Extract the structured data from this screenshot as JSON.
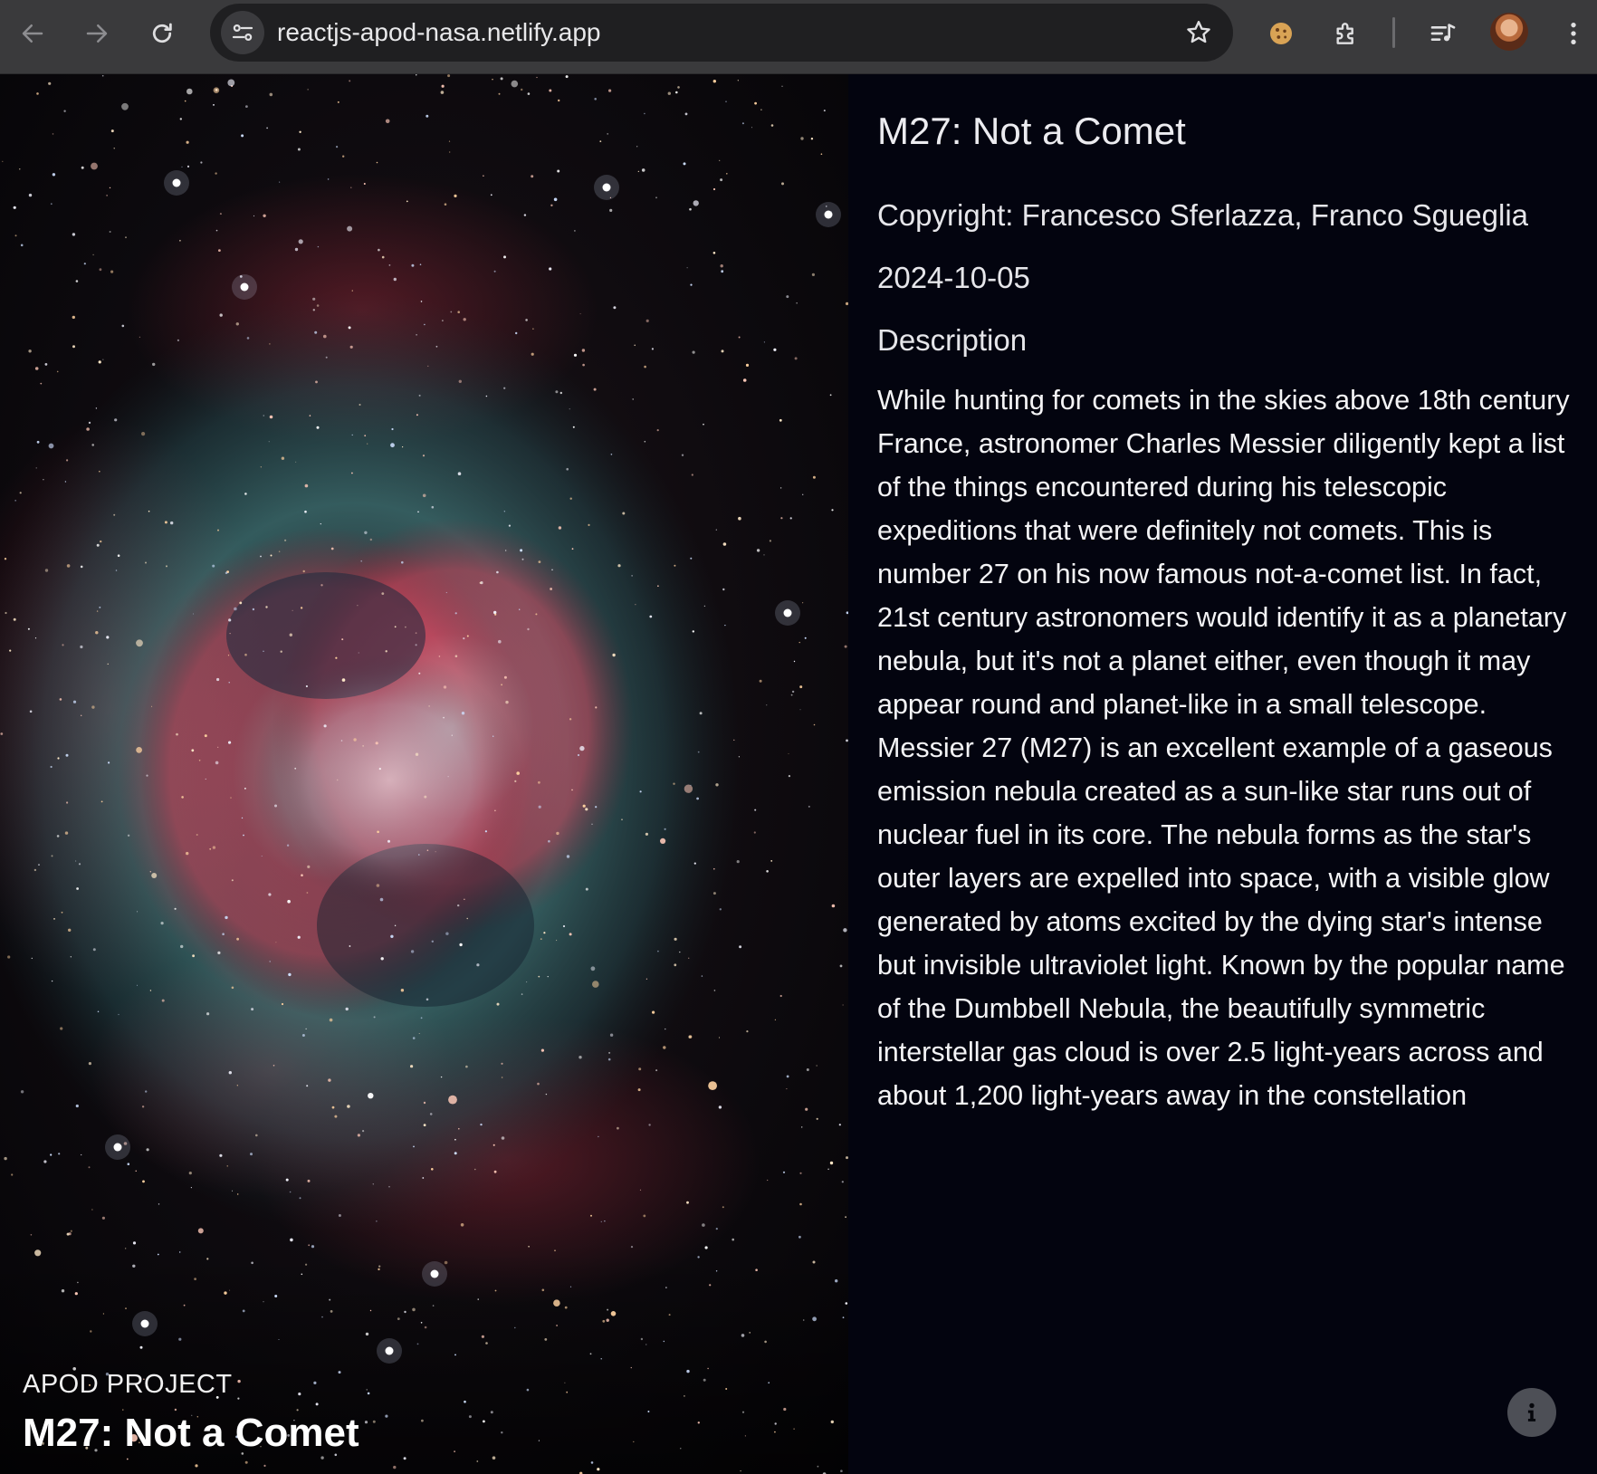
{
  "browser": {
    "url": "reactjs-apod-nasa.netlify.app",
    "icons": [
      "back-arrow-icon",
      "forward-arrow-icon",
      "reload-icon",
      "site-settings-icon",
      "bookmark-star-icon",
      "cookie-extension-icon",
      "extensions-puzzle-icon",
      "media-queue-icon",
      "profile-avatar",
      "more-menu-icon"
    ]
  },
  "hero": {
    "kicker": "APOD PROJECT",
    "title": "M27: Not a Comet"
  },
  "details": {
    "title": "M27: Not a Comet",
    "copyright": "Copyright: Francesco Sferlazza, Franco Sgueglia",
    "date": "2024-10-05",
    "description_heading": "Description",
    "description": "While hunting for comets in the skies above 18th century France, astronomer Charles Messier diligently kept a list of the things encountered during his telescopic expeditions that were definitely not comets. This is number 27 on his now famous not-a-comet list. In fact, 21st century astronomers would identify it as a planetary nebula, but it's not a planet either, even though it may appear round and planet-like in a small telescope. Messier 27 (M27) is an excellent example of a gaseous emission nebula created as a sun-like star runs out of nuclear fuel in its core. The nebula forms as the star's outer layers are expelled into space, with a visible glow generated by atoms excited by the dying star's intense but invisible ultraviolet light. Known by the popular name of the Dumbbell Nebula, the beautifully symmetric interstellar gas cloud is over 2.5 light-years across and about 1,200 light-years away in the constellation"
  },
  "info_button": {
    "icon": "info-icon"
  },
  "colors": {
    "chrome_bar": "#3a3a3c",
    "omnibox": "#1f1f21",
    "page_background": "#03040f",
    "nebula_red": "#e0506a",
    "nebula_teal": "#4d9a9a"
  }
}
